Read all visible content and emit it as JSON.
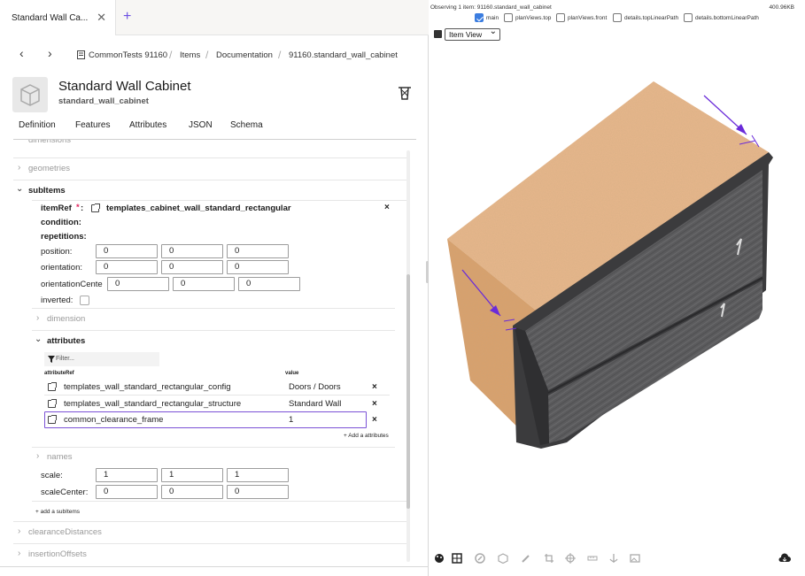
{
  "tab": {
    "title": "Standard Wall Ca...",
    "close": "✕",
    "add": "+"
  },
  "nav": {
    "back": "‹",
    "forward": "›",
    "breadcrumb": [
      "CommonTests 91160",
      "Items",
      "Documentation",
      "91160.standard_wall_cabinet"
    ],
    "sep": "/"
  },
  "header": {
    "title": "Standard Wall Cabinet",
    "subtitle": "standard_wall_cabinet"
  },
  "def_tabs": [
    "Definition",
    "Features",
    "Attributes",
    "JSON",
    "Schema"
  ],
  "tree": {
    "dimensions_partial": "dimensions",
    "geometries": "geometries",
    "subitems": "subItems",
    "itemref_label": "itemRef",
    "itemref_star": "*",
    "itemref_colon": ":",
    "itemref_value": "templates_cabinet_wall_standard_rectangular",
    "condition": "condition:",
    "repetitions": "repetitions:",
    "position_label": "position:",
    "position": [
      "0",
      "0",
      "0"
    ],
    "orientation_label": "orientation:",
    "orientation": [
      "0",
      "0",
      "0"
    ],
    "orientation_center_label": "orientationCente",
    "orientation_center": [
      "0",
      "0",
      "0"
    ],
    "inverted_label": "inverted:",
    "dimension": "dimension",
    "attributes": "attributes",
    "filter_placeholder": "Filter...",
    "col_ref": "attributeRef",
    "col_value": "value",
    "attr_rows": [
      {
        "ref": "templates_wall_standard_rectangular_config",
        "value": "Doors / Doors"
      },
      {
        "ref": "templates_wall_standard_rectangular_structure",
        "value": "Standard Wall"
      },
      {
        "ref": "common_clearance_frame",
        "value": "1"
      }
    ],
    "add_attributes": "+ Add a attributes",
    "names": "names",
    "scale_label": "scale:",
    "scale": [
      "1",
      "1",
      "1"
    ],
    "scale_center_label": "scaleCenter:",
    "scale_center": [
      "0",
      "0",
      "0"
    ],
    "add_subitems": "+ add a subItems",
    "clearance": "clearanceDistances",
    "insertion": "insertionOffsets",
    "remove": "×"
  },
  "viewer": {
    "status": "Observing 1 item: 91160.standard_wall_cabinet",
    "size": "400.96KB",
    "checks": [
      {
        "label": "main",
        "checked": true
      },
      {
        "label": "planViews.top",
        "checked": false
      },
      {
        "label": "planViews.front",
        "checked": false
      },
      {
        "label": "details.topLinearPath",
        "checked": false
      },
      {
        "label": "details.bottomLinearPath",
        "checked": false
      }
    ],
    "view_mode": "Item View"
  },
  "colors": {
    "accent": "#6b4fe3",
    "highlight_border": "#7b52d6",
    "arrow": "#6a2bd9",
    "wood_top": "#e9b88a",
    "door": "#5d5d5f"
  }
}
